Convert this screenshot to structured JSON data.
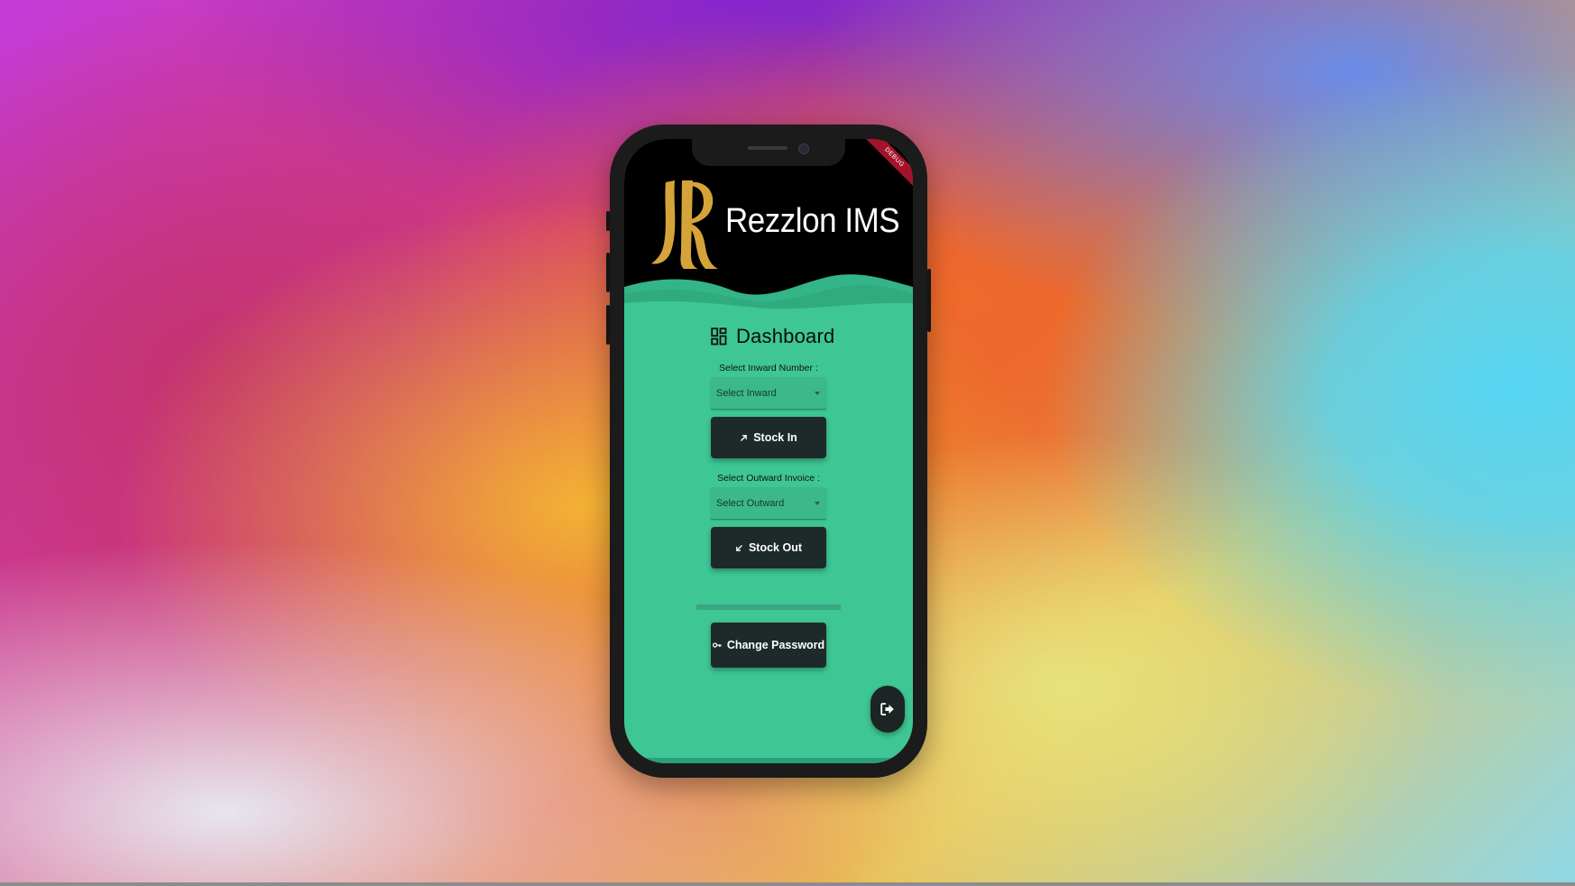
{
  "app": {
    "title": "Rezzlon IMS",
    "debug_banner": "DEBUG"
  },
  "dashboard": {
    "title": "Dashboard",
    "inward": {
      "label": "Select Inward Number :",
      "placeholder": "Select Inward",
      "button_label": "Stock In"
    },
    "outward": {
      "label": "Select Outward Invoice :",
      "placeholder": "Select Outward",
      "button_label": "Stock Out"
    },
    "change_password_label": "Change Password"
  },
  "icons": {
    "logo": "rezzlon-r-logo",
    "dashboard": "dashboard-grid-icon",
    "stock_in": "arrow-up-right-icon",
    "stock_out": "arrow-down-left-icon",
    "change_password": "key-icon",
    "logout": "logout-icon"
  },
  "colors": {
    "screen_background": "#3ec694",
    "header_background": "#000000",
    "logo_gold": "#d4a43a",
    "button_background": "#1e2a2a"
  }
}
